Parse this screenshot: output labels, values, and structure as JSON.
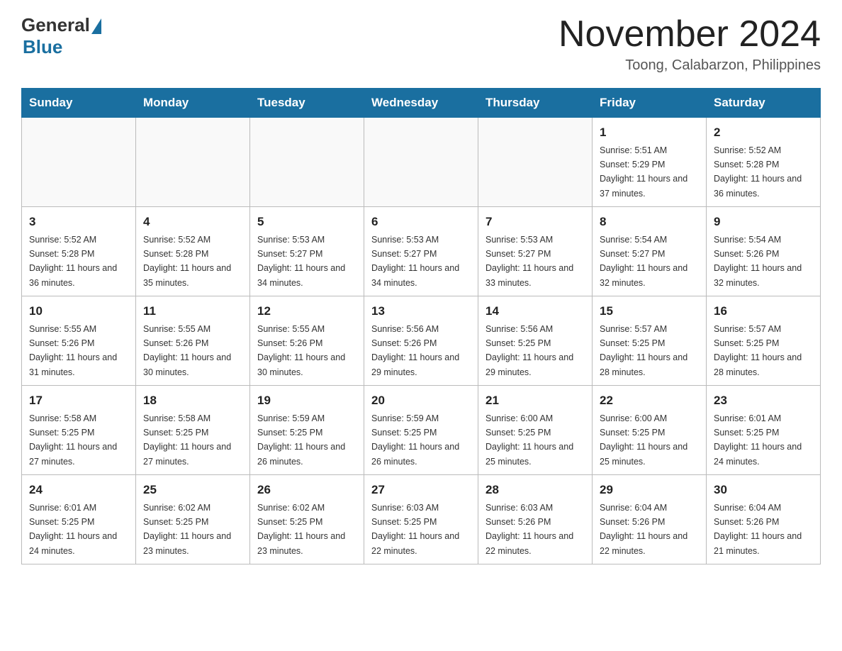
{
  "logo": {
    "general": "General",
    "blue": "Blue"
  },
  "title": "November 2024",
  "subtitle": "Toong, Calabarzon, Philippines",
  "days_header": [
    "Sunday",
    "Monday",
    "Tuesday",
    "Wednesday",
    "Thursday",
    "Friday",
    "Saturday"
  ],
  "weeks": [
    [
      {
        "day": "",
        "info": ""
      },
      {
        "day": "",
        "info": ""
      },
      {
        "day": "",
        "info": ""
      },
      {
        "day": "",
        "info": ""
      },
      {
        "day": "",
        "info": ""
      },
      {
        "day": "1",
        "info": "Sunrise: 5:51 AM\nSunset: 5:29 PM\nDaylight: 11 hours and 37 minutes."
      },
      {
        "day": "2",
        "info": "Sunrise: 5:52 AM\nSunset: 5:28 PM\nDaylight: 11 hours and 36 minutes."
      }
    ],
    [
      {
        "day": "3",
        "info": "Sunrise: 5:52 AM\nSunset: 5:28 PM\nDaylight: 11 hours and 36 minutes."
      },
      {
        "day": "4",
        "info": "Sunrise: 5:52 AM\nSunset: 5:28 PM\nDaylight: 11 hours and 35 minutes."
      },
      {
        "day": "5",
        "info": "Sunrise: 5:53 AM\nSunset: 5:27 PM\nDaylight: 11 hours and 34 minutes."
      },
      {
        "day": "6",
        "info": "Sunrise: 5:53 AM\nSunset: 5:27 PM\nDaylight: 11 hours and 34 minutes."
      },
      {
        "day": "7",
        "info": "Sunrise: 5:53 AM\nSunset: 5:27 PM\nDaylight: 11 hours and 33 minutes."
      },
      {
        "day": "8",
        "info": "Sunrise: 5:54 AM\nSunset: 5:27 PM\nDaylight: 11 hours and 32 minutes."
      },
      {
        "day": "9",
        "info": "Sunrise: 5:54 AM\nSunset: 5:26 PM\nDaylight: 11 hours and 32 minutes."
      }
    ],
    [
      {
        "day": "10",
        "info": "Sunrise: 5:55 AM\nSunset: 5:26 PM\nDaylight: 11 hours and 31 minutes."
      },
      {
        "day": "11",
        "info": "Sunrise: 5:55 AM\nSunset: 5:26 PM\nDaylight: 11 hours and 30 minutes."
      },
      {
        "day": "12",
        "info": "Sunrise: 5:55 AM\nSunset: 5:26 PM\nDaylight: 11 hours and 30 minutes."
      },
      {
        "day": "13",
        "info": "Sunrise: 5:56 AM\nSunset: 5:26 PM\nDaylight: 11 hours and 29 minutes."
      },
      {
        "day": "14",
        "info": "Sunrise: 5:56 AM\nSunset: 5:25 PM\nDaylight: 11 hours and 29 minutes."
      },
      {
        "day": "15",
        "info": "Sunrise: 5:57 AM\nSunset: 5:25 PM\nDaylight: 11 hours and 28 minutes."
      },
      {
        "day": "16",
        "info": "Sunrise: 5:57 AM\nSunset: 5:25 PM\nDaylight: 11 hours and 28 minutes."
      }
    ],
    [
      {
        "day": "17",
        "info": "Sunrise: 5:58 AM\nSunset: 5:25 PM\nDaylight: 11 hours and 27 minutes."
      },
      {
        "day": "18",
        "info": "Sunrise: 5:58 AM\nSunset: 5:25 PM\nDaylight: 11 hours and 27 minutes."
      },
      {
        "day": "19",
        "info": "Sunrise: 5:59 AM\nSunset: 5:25 PM\nDaylight: 11 hours and 26 minutes."
      },
      {
        "day": "20",
        "info": "Sunrise: 5:59 AM\nSunset: 5:25 PM\nDaylight: 11 hours and 26 minutes."
      },
      {
        "day": "21",
        "info": "Sunrise: 6:00 AM\nSunset: 5:25 PM\nDaylight: 11 hours and 25 minutes."
      },
      {
        "day": "22",
        "info": "Sunrise: 6:00 AM\nSunset: 5:25 PM\nDaylight: 11 hours and 25 minutes."
      },
      {
        "day": "23",
        "info": "Sunrise: 6:01 AM\nSunset: 5:25 PM\nDaylight: 11 hours and 24 minutes."
      }
    ],
    [
      {
        "day": "24",
        "info": "Sunrise: 6:01 AM\nSunset: 5:25 PM\nDaylight: 11 hours and 24 minutes."
      },
      {
        "day": "25",
        "info": "Sunrise: 6:02 AM\nSunset: 5:25 PM\nDaylight: 11 hours and 23 minutes."
      },
      {
        "day": "26",
        "info": "Sunrise: 6:02 AM\nSunset: 5:25 PM\nDaylight: 11 hours and 23 minutes."
      },
      {
        "day": "27",
        "info": "Sunrise: 6:03 AM\nSunset: 5:25 PM\nDaylight: 11 hours and 22 minutes."
      },
      {
        "day": "28",
        "info": "Sunrise: 6:03 AM\nSunset: 5:26 PM\nDaylight: 11 hours and 22 minutes."
      },
      {
        "day": "29",
        "info": "Sunrise: 6:04 AM\nSunset: 5:26 PM\nDaylight: 11 hours and 22 minutes."
      },
      {
        "day": "30",
        "info": "Sunrise: 6:04 AM\nSunset: 5:26 PM\nDaylight: 11 hours and 21 minutes."
      }
    ]
  ]
}
